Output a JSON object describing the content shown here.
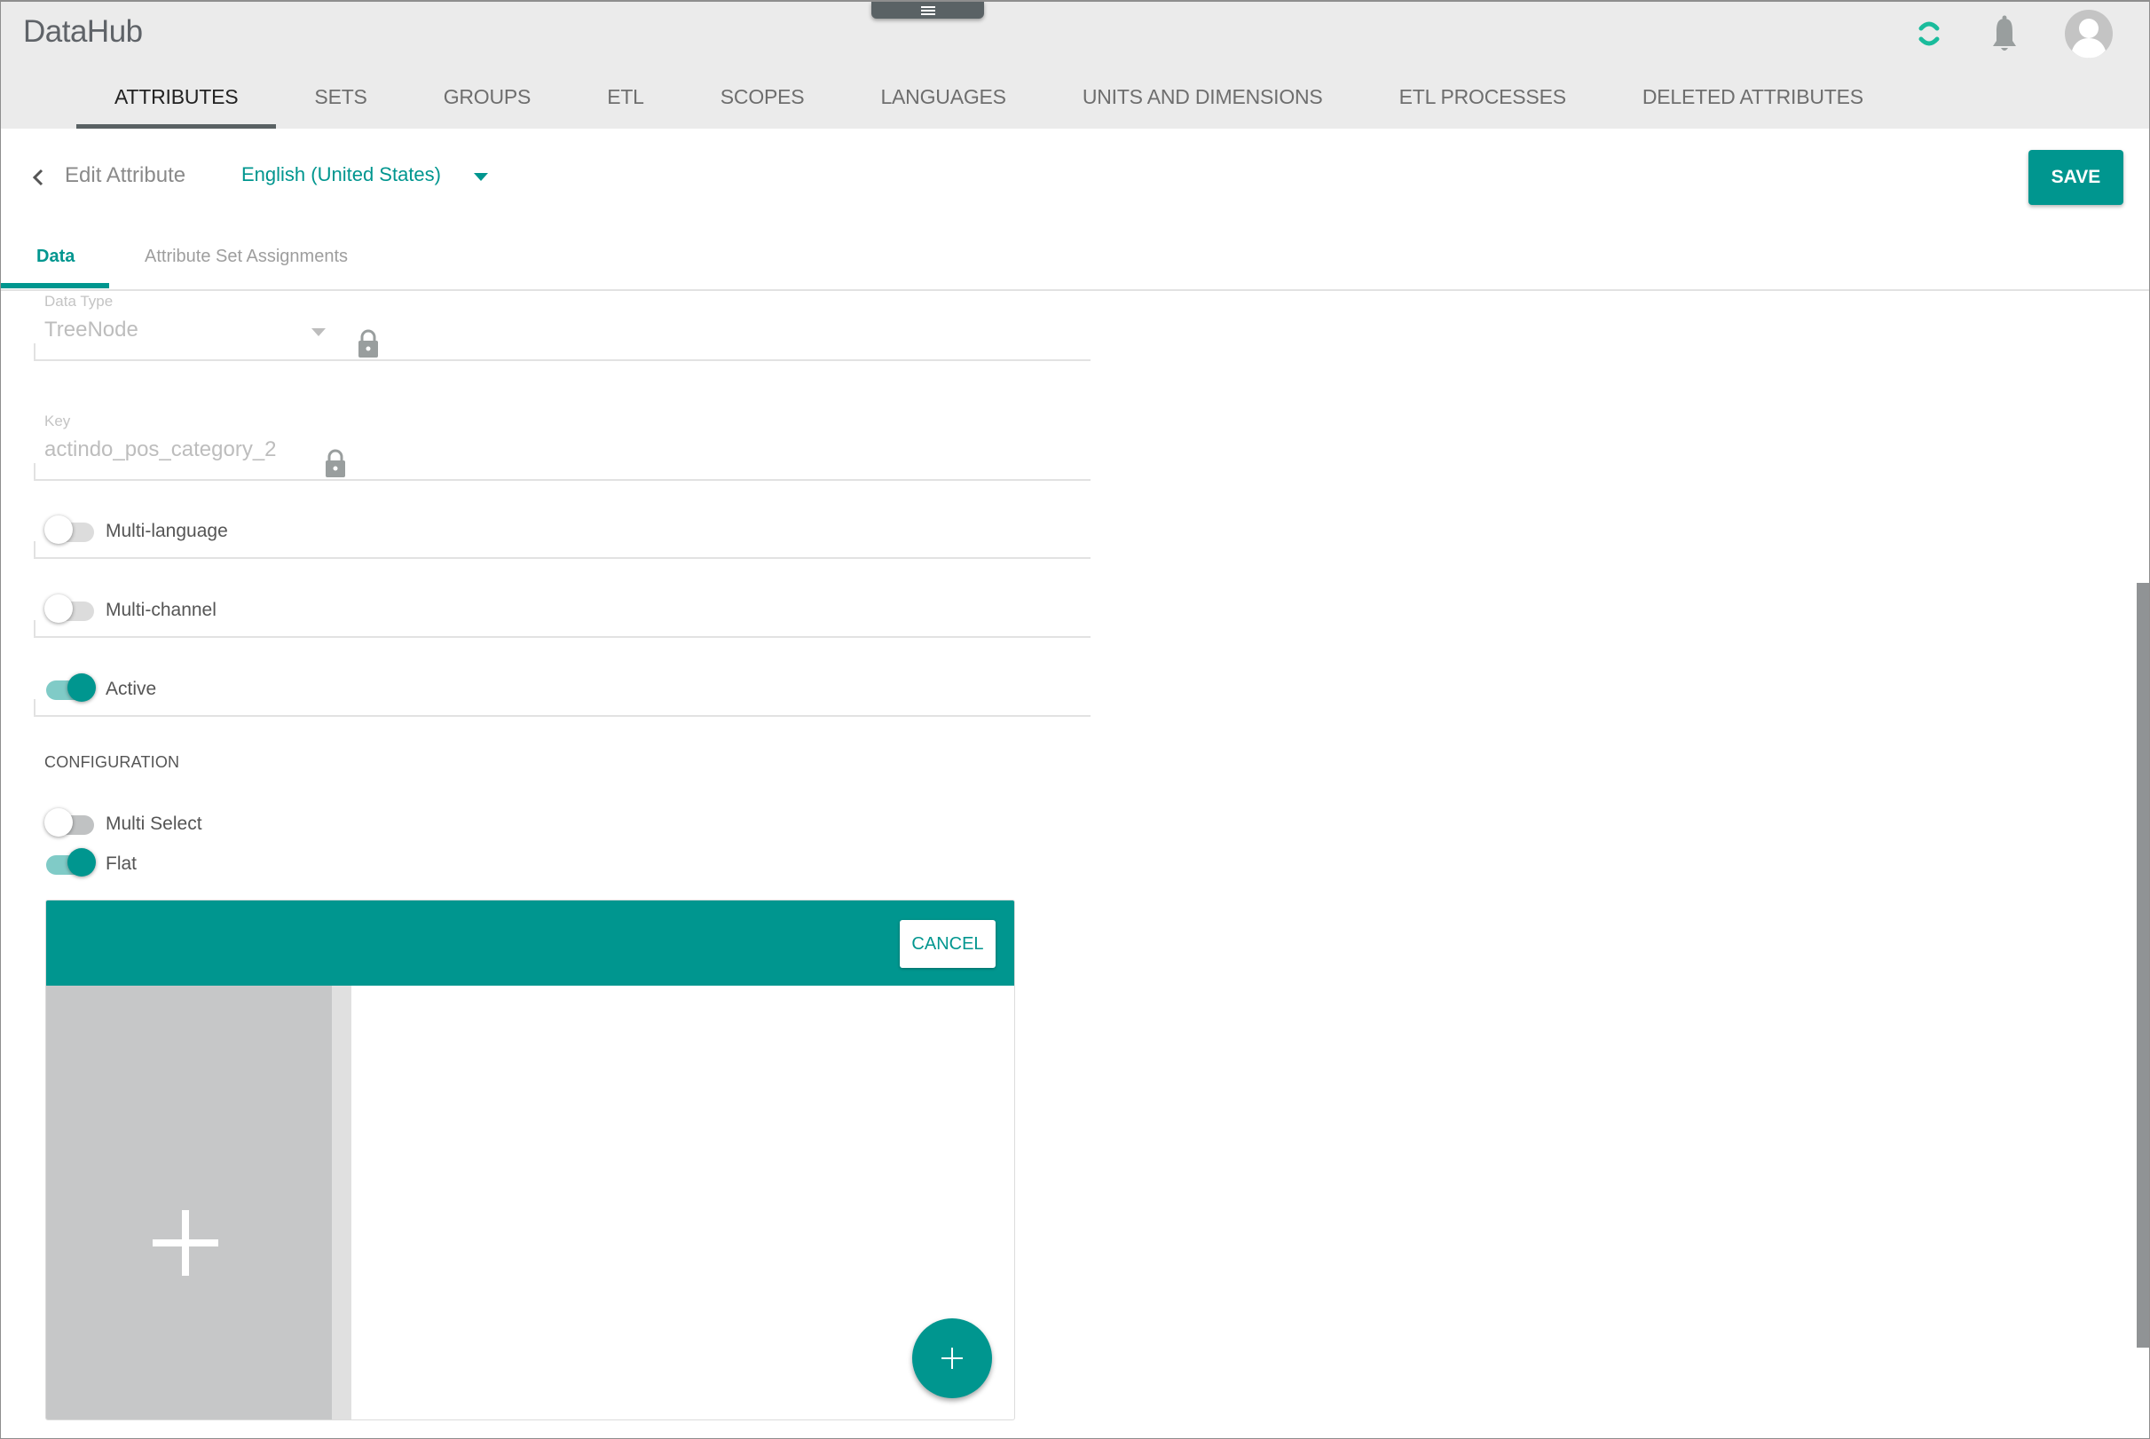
{
  "app": {
    "title": "DataHub",
    "icons": {
      "sync": "sync-icon",
      "notifications": "bell-icon",
      "account": "avatar-icon",
      "drawer": "menu-handle-icon"
    },
    "accent_color": "#00968f"
  },
  "nav": {
    "tabs": [
      {
        "label": "ATTRIBUTES",
        "active": true
      },
      {
        "label": "SETS",
        "active": false
      },
      {
        "label": "GROUPS",
        "active": false
      },
      {
        "label": "ETL",
        "active": false
      },
      {
        "label": "SCOPES",
        "active": false
      },
      {
        "label": "LANGUAGES",
        "active": false
      },
      {
        "label": "UNITS AND DIMENSIONS",
        "active": false
      },
      {
        "label": "ETL PROCESSES",
        "active": false
      },
      {
        "label": "DELETED ATTRIBUTES",
        "active": false
      }
    ]
  },
  "header": {
    "title": "Edit Attribute",
    "language": "English (United States)",
    "save_label": "SAVE"
  },
  "tabs": {
    "data": "Data",
    "assignments": "Attribute Set Assignments",
    "active": "Data"
  },
  "form": {
    "data_type": {
      "label": "Data Type",
      "value": "TreeNode",
      "locked": true
    },
    "key": {
      "label": "Key",
      "value": "actindo_pos_category_2",
      "locked": true
    },
    "toggles": [
      {
        "label": "Multi-language",
        "checked": false
      },
      {
        "label": "Multi-channel",
        "checked": false
      },
      {
        "label": "Active",
        "checked": true
      }
    ]
  },
  "configuration": {
    "title": "CONFIGURATION",
    "toggles": [
      {
        "label": "Multi Select",
        "checked": false
      },
      {
        "label": "Flat",
        "checked": true
      }
    ]
  },
  "tree_editor": {
    "cancel_label": "CANCEL",
    "add_node_icon": "plus-icon",
    "fab_icon": "plus-icon"
  }
}
